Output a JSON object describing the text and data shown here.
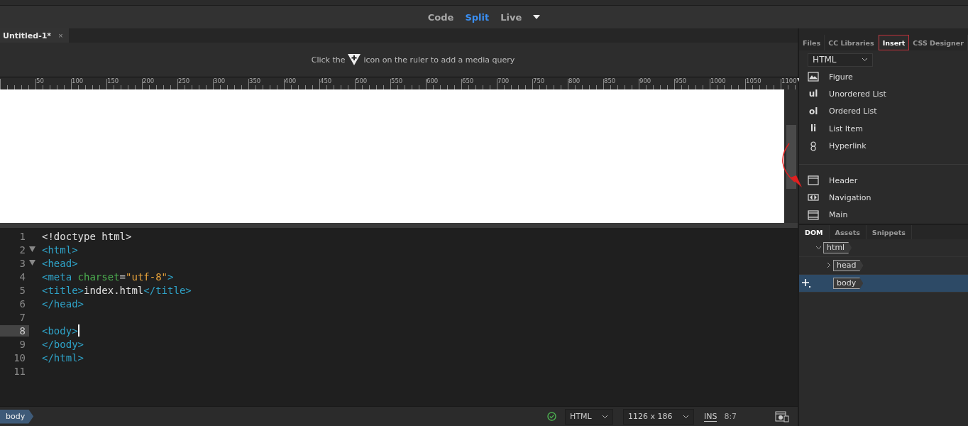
{
  "view_switcher": [
    {
      "label": "Code",
      "selected": false
    },
    {
      "label": "Split",
      "selected": true
    },
    {
      "label": "Live",
      "selected": false
    }
  ],
  "document_tabs": [
    {
      "label": "Untitled-1*",
      "close": "×",
      "selected": true
    }
  ],
  "media_query_hint": {
    "before": "Click the",
    "after": "icon on the ruler to add a media query"
  },
  "ruler": {
    "labels": [
      "50",
      "100",
      "150",
      "200",
      "250",
      "300",
      "350",
      "400",
      "450",
      "500",
      "550",
      "600",
      "650",
      "700",
      "750",
      "800",
      "850",
      "900",
      "950",
      "1000",
      "1050",
      "1100"
    ]
  },
  "code": [
    {
      "number": "1",
      "foldable": false,
      "selected": false,
      "tokens": [
        {
          "kind": "plain",
          "text": "<!doctype html>"
        }
      ]
    },
    {
      "number": "2",
      "foldable": true,
      "selected": false,
      "tokens": [
        {
          "kind": "tag",
          "text": "<html>"
        }
      ]
    },
    {
      "number": "3",
      "foldable": true,
      "selected": false,
      "tokens": [
        {
          "kind": "tag",
          "text": "<head>"
        }
      ]
    },
    {
      "number": "4",
      "foldable": false,
      "selected": false,
      "tokens": [
        {
          "kind": "tag",
          "text": "<meta "
        },
        {
          "kind": "attr",
          "text": "charset"
        },
        {
          "kind": "plain",
          "text": "="
        },
        {
          "kind": "string",
          "text": "\"utf-8\""
        },
        {
          "kind": "tag",
          "text": ">"
        }
      ]
    },
    {
      "number": "5",
      "foldable": false,
      "selected": false,
      "tokens": [
        {
          "kind": "tag",
          "text": "<title>"
        },
        {
          "kind": "plain",
          "text": "index.html"
        },
        {
          "kind": "tag",
          "text": "</title>"
        }
      ]
    },
    {
      "number": "6",
      "foldable": false,
      "selected": false,
      "tokens": [
        {
          "kind": "tag",
          "text": "</head>"
        }
      ]
    },
    {
      "number": "7",
      "foldable": false,
      "selected": false
    },
    {
      "number": "8",
      "foldable": false,
      "selected": true,
      "tokens": [
        {
          "kind": "tag",
          "text": "<body>"
        }
      ]
    },
    {
      "number": "9",
      "foldable": false,
      "selected": false,
      "tokens": [
        {
          "kind": "tag",
          "text": "</body>"
        }
      ]
    },
    {
      "number": "10",
      "foldable": false,
      "selected": false,
      "tokens": [
        {
          "kind": "tag",
          "text": "</html>"
        }
      ]
    },
    {
      "number": "11",
      "foldable": false,
      "selected": false
    }
  ],
  "status_bar": {
    "breadcrumb": "body",
    "language": "HTML",
    "size": "1126 x 186",
    "mode": "INS",
    "position": "8:7"
  },
  "panel_tabs": [
    {
      "label": "Files",
      "selected": false
    },
    {
      "label": "CC Libraries",
      "selected": false
    },
    {
      "label": "Insert",
      "selected": true
    },
    {
      "label": "CSS Designer",
      "selected": false
    }
  ],
  "insert_category": "HTML",
  "insert_groups": [
    [
      {
        "kind": "figure",
        "label": "Figure"
      },
      {
        "kind": "glyph",
        "glyph": "ul",
        "label": "Unordered List"
      },
      {
        "kind": "glyph",
        "glyph": "ol",
        "label": "Ordered List"
      },
      {
        "kind": "glyph",
        "glyph": "li",
        "label": "List Item"
      },
      {
        "kind": "hyperlink",
        "label": "Hyperlink"
      }
    ],
    [
      {
        "kind": "header",
        "label": "Header"
      },
      {
        "kind": "navigation",
        "label": "Navigation"
      },
      {
        "kind": "main",
        "label": "Main"
      }
    ]
  ],
  "lower_tabs": [
    {
      "label": "DOM",
      "selected": true
    },
    {
      "label": "Assets",
      "selected": false
    },
    {
      "label": "Snippets",
      "selected": false
    }
  ],
  "dom_tree": [
    {
      "tag": "html",
      "expanded": true,
      "selected": false,
      "children": [
        {
          "tag": "head",
          "expanded": false,
          "selected": false,
          "has_children": true
        },
        {
          "tag": "body",
          "selected": true
        }
      ]
    }
  ]
}
